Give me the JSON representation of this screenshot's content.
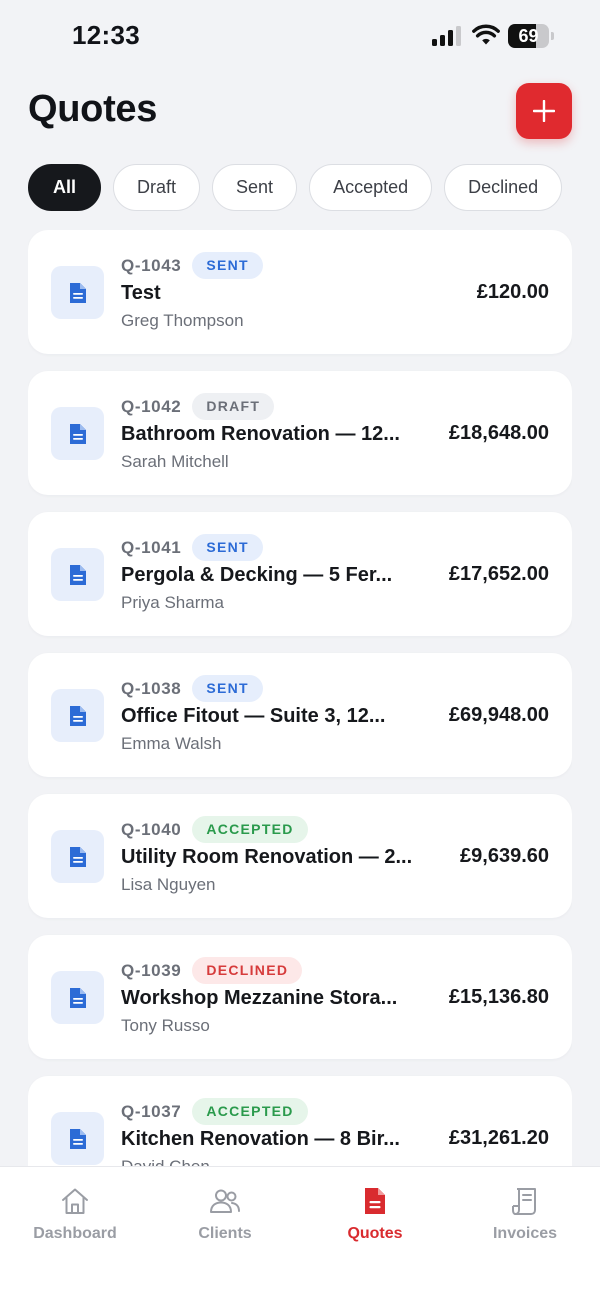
{
  "status_bar": {
    "time": "12:33",
    "battery": "69",
    "battery_level": 0.69
  },
  "header": {
    "title": "Quotes",
    "add_icon": "plus-icon"
  },
  "filters": [
    {
      "label": "All",
      "active": true
    },
    {
      "label": "Draft",
      "active": false
    },
    {
      "label": "Sent",
      "active": false
    },
    {
      "label": "Accepted",
      "active": false
    },
    {
      "label": "Declined",
      "active": false
    }
  ],
  "quotes": [
    {
      "number": "Q-1043",
      "status": "SENT",
      "title": "Test",
      "client": "Greg Thompson",
      "amount": "£120.00"
    },
    {
      "number": "Q-1042",
      "status": "DRAFT",
      "title": "Bathroom Renovation — 12...",
      "client": "Sarah Mitchell",
      "amount": "£18,648.00"
    },
    {
      "number": "Q-1041",
      "status": "SENT",
      "title": "Pergola & Decking — 5 Fer...",
      "client": "Priya Sharma",
      "amount": "£17,652.00"
    },
    {
      "number": "Q-1038",
      "status": "SENT",
      "title": "Office Fitout — Suite 3, 12...",
      "client": "Emma Walsh",
      "amount": "£69,948.00"
    },
    {
      "number": "Q-1040",
      "status": "ACCEPTED",
      "title": "Utility Room Renovation — 2...",
      "client": "Lisa Nguyen",
      "amount": "£9,639.60"
    },
    {
      "number": "Q-1039",
      "status": "DECLINED",
      "title": "Workshop Mezzanine Stora...",
      "client": "Tony Russo",
      "amount": "£15,136.80"
    },
    {
      "number": "Q-1037",
      "status": "ACCEPTED",
      "title": "Kitchen Renovation — 8 Bir...",
      "client": "David Chen",
      "amount": "£31,261.20"
    }
  ],
  "tabs": [
    {
      "label": "Dashboard",
      "icon": "home-icon",
      "active": false
    },
    {
      "label": "Clients",
      "icon": "users-icon",
      "active": false
    },
    {
      "label": "Quotes",
      "icon": "document-icon",
      "active": true
    },
    {
      "label": "Invoices",
      "icon": "receipt-icon",
      "active": false
    }
  ],
  "colors": {
    "accent": "#e02a2f",
    "sent": "#2c6bd6",
    "draft": "#6b6f78",
    "accepted": "#2a9a4c",
    "declined": "#d63b3b"
  }
}
